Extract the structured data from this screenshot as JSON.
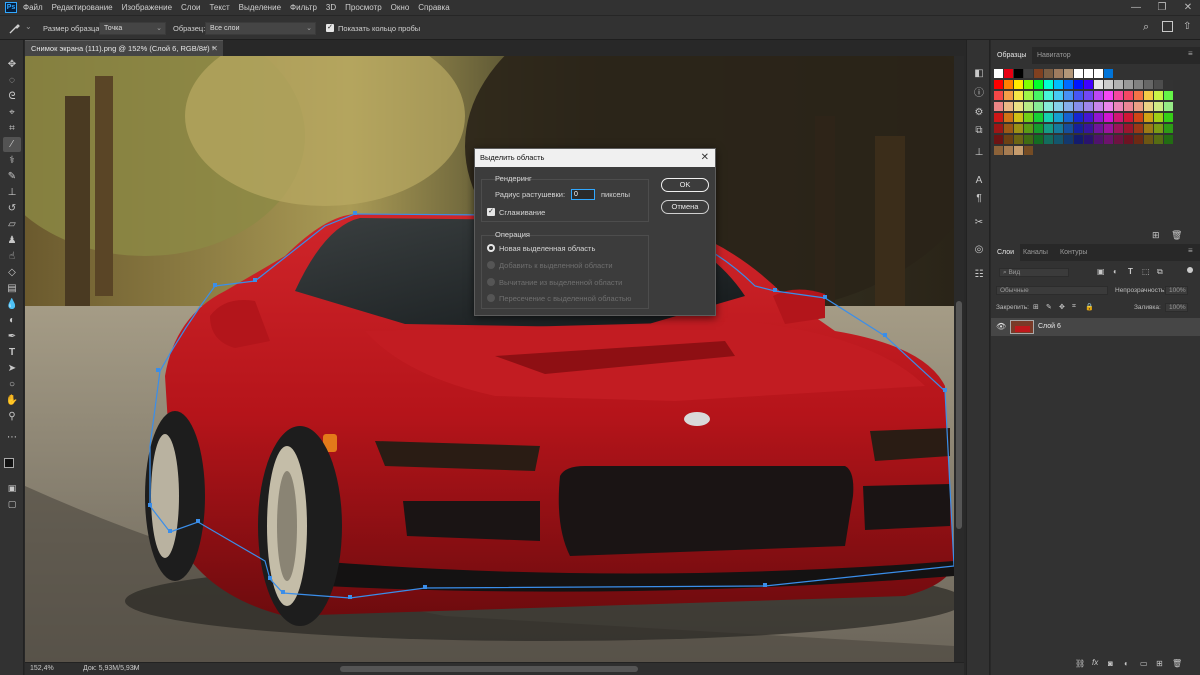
{
  "menu": {
    "app_icon": "Ps",
    "items": [
      "Файл",
      "Редактирование",
      "Изображение",
      "Слои",
      "Текст",
      "Выделение",
      "Фильтр",
      "3D",
      "Просмотр",
      "Окно",
      "Справка"
    ],
    "window_controls": [
      "—",
      "❐",
      "✕"
    ]
  },
  "options": {
    "sample_size_label": "Размер образца:",
    "sample_size_value": "Точка",
    "sample_label": "Образец:",
    "sample_value": "Все слои",
    "show_ring_label": "Показать кольцо пробы",
    "show_ring_checked": true
  },
  "document": {
    "tab_title": "Снимок экрана (111).png @ 152% (Слой 6, RGB/8#) *",
    "zoom": "152,4%",
    "doc_size": "Док: 5,93M/5,93M"
  },
  "dialog": {
    "title": "Выделить область",
    "rendering_title": "Рендеринг",
    "feather_label": "Радиус растушевки:",
    "feather_value": "0",
    "feather_unit": "пикселы",
    "antialias_label": "Сглаживание",
    "antialias_checked": true,
    "ok_label": "OK",
    "cancel_label": "Отмена",
    "operation_title": "Операция",
    "operations": [
      {
        "label": "Новая выделенная область",
        "selected": true,
        "enabled": true
      },
      {
        "label": "Добавить к выделенной области",
        "selected": false,
        "enabled": false
      },
      {
        "label": "Вычитание из выделенной области",
        "selected": false,
        "enabled": false
      },
      {
        "label": "Пересечение с выделенной областью",
        "selected": false,
        "enabled": false
      }
    ]
  },
  "swatches_panel": {
    "tabs": [
      "Образцы",
      "Навигатор"
    ]
  },
  "layers_panel": {
    "tabs": [
      "Слои",
      "Каналы",
      "Контуры"
    ],
    "filter_placeholder": "Вид",
    "blend_mode": "Обычные",
    "opacity_label": "Непрозрачность:",
    "opacity_value": "100%",
    "lock_label": "Закрепить:",
    "fill_label": "Заливка:",
    "fill_value": "100%",
    "layers": [
      {
        "name": "Слой 6",
        "visible": true,
        "selected": true
      }
    ],
    "footer_icons": [
      "link-icon",
      "fx-icon",
      "mask-icon",
      "adjustment-icon",
      "group-icon",
      "new-layer-icon",
      "trash-icon"
    ]
  },
  "colors": {
    "accent": "#31a8ff",
    "panel_bg": "#323232",
    "selection_path": "#3a8eea",
    "car_red": "#c4161c"
  }
}
